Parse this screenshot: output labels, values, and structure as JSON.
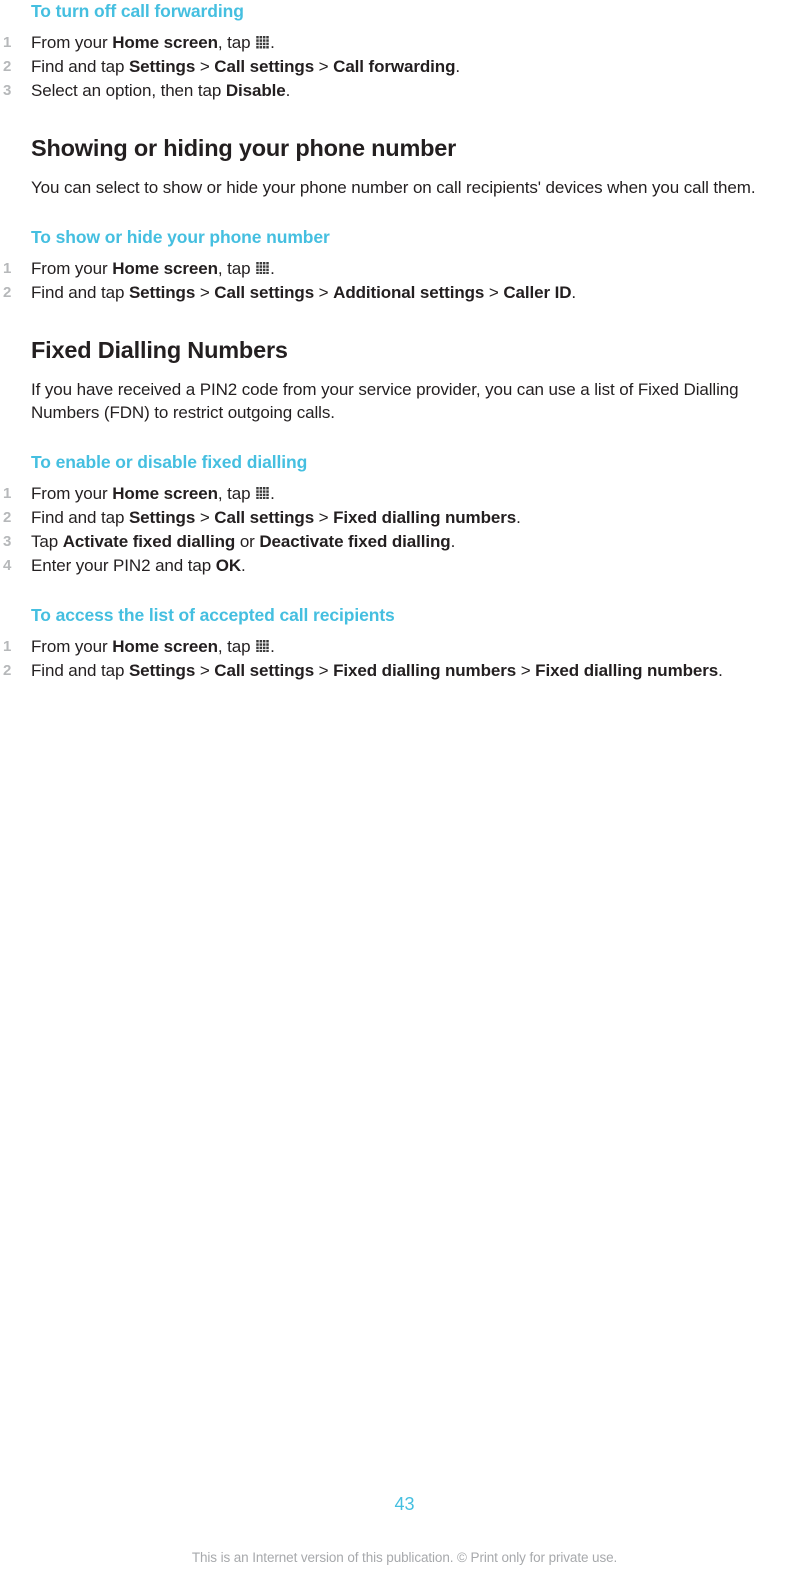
{
  "page": {
    "number": "43",
    "disclaimer": "This is an Internet version of this publication. © Print only for private use.",
    "accent_color": "#45bfe0",
    "text_color": "#231f20",
    "marker_color": "#b6b8ba",
    "footer_color": "#a7a9ac"
  },
  "icons": {
    "app_drawer": "grid-icon"
  },
  "blocks": {
    "proc_turn_off_call_forwarding": {
      "title": "To turn off call forwarding",
      "steps": [
        {
          "parts": [
            {
              "t": "From your ",
              "b": false
            },
            {
              "t": "Home screen",
              "b": true
            },
            {
              "t": ", tap ",
              "b": false
            },
            {
              "t": "ICON",
              "b": false,
              "icon": true
            },
            {
              "t": ".",
              "b": false
            }
          ]
        },
        {
          "parts": [
            {
              "t": "Find and tap ",
              "b": false
            },
            {
              "t": "Settings",
              "b": true
            },
            {
              "t": " > ",
              "b": false,
              "sep": true
            },
            {
              "t": "Call settings",
              "b": true
            },
            {
              "t": " > ",
              "b": false,
              "sep": true
            },
            {
              "t": "Call forwarding",
              "b": true
            },
            {
              "t": ".",
              "b": false
            }
          ]
        },
        {
          "parts": [
            {
              "t": "Select an option, then tap ",
              "b": false
            },
            {
              "t": "Disable",
              "b": true
            },
            {
              "t": ".",
              "b": false
            }
          ]
        }
      ]
    },
    "section_showing_hiding": {
      "title": "Showing or hiding your phone number",
      "paragraph": "You can select to show or hide your phone number on call recipients' devices when you call them."
    },
    "proc_show_hide_number": {
      "title": "To show or hide your phone number",
      "steps": [
        {
          "parts": [
            {
              "t": "From your ",
              "b": false
            },
            {
              "t": "Home screen",
              "b": true
            },
            {
              "t": ", tap ",
              "b": false
            },
            {
              "t": "ICON",
              "b": false,
              "icon": true
            },
            {
              "t": ".",
              "b": false
            }
          ]
        },
        {
          "parts": [
            {
              "t": "Find and tap ",
              "b": false
            },
            {
              "t": "Settings",
              "b": true
            },
            {
              "t": " > ",
              "b": false,
              "sep": true
            },
            {
              "t": "Call settings",
              "b": true
            },
            {
              "t": " > ",
              "b": false,
              "sep": true
            },
            {
              "t": "Additional settings",
              "b": true
            },
            {
              "t": " > ",
              "b": false,
              "sep": true
            },
            {
              "t": "Caller ID",
              "b": true
            },
            {
              "t": ".",
              "b": false
            }
          ]
        }
      ]
    },
    "section_fixed_dialling": {
      "title": "Fixed Dialling Numbers",
      "paragraph": "If you have received a PIN2 code from your service provider, you can use a list of Fixed Dialling Numbers (FDN) to restrict outgoing calls."
    },
    "proc_enable_disable_fixed_dialling": {
      "title": "To enable or disable fixed dialling",
      "steps": [
        {
          "parts": [
            {
              "t": "From your ",
              "b": false
            },
            {
              "t": "Home screen",
              "b": true
            },
            {
              "t": ", tap ",
              "b": false
            },
            {
              "t": "ICON",
              "b": false,
              "icon": true
            },
            {
              "t": ".",
              "b": false
            }
          ]
        },
        {
          "parts": [
            {
              "t": "Find and tap ",
              "b": false
            },
            {
              "t": "Settings",
              "b": true
            },
            {
              "t": " > ",
              "b": false,
              "sep": true
            },
            {
              "t": "Call settings",
              "b": true
            },
            {
              "t": " > ",
              "b": false,
              "sep": true
            },
            {
              "t": "Fixed dialling numbers",
              "b": true
            },
            {
              "t": ".",
              "b": false
            }
          ]
        },
        {
          "parts": [
            {
              "t": "Tap ",
              "b": false
            },
            {
              "t": "Activate fixed dialling",
              "b": true
            },
            {
              "t": " or ",
              "b": false
            },
            {
              "t": "Deactivate fixed dialling",
              "b": true
            },
            {
              "t": ".",
              "b": false
            }
          ]
        },
        {
          "parts": [
            {
              "t": "Enter your PIN2 and tap ",
              "b": false
            },
            {
              "t": "OK",
              "b": true
            },
            {
              "t": ".",
              "b": false
            }
          ]
        }
      ]
    },
    "proc_access_accepted_recipients": {
      "title": "To access the list of accepted call recipients",
      "steps": [
        {
          "parts": [
            {
              "t": "From your ",
              "b": false
            },
            {
              "t": "Home screen",
              "b": true
            },
            {
              "t": ", tap ",
              "b": false
            },
            {
              "t": "ICON",
              "b": false,
              "icon": true
            },
            {
              "t": ".",
              "b": false
            }
          ]
        },
        {
          "parts": [
            {
              "t": "Find and tap ",
              "b": false
            },
            {
              "t": "Settings",
              "b": true
            },
            {
              "t": " > ",
              "b": false,
              "sep": true
            },
            {
              "t": "Call settings",
              "b": true
            },
            {
              "t": " > ",
              "b": false,
              "sep": true
            },
            {
              "t": "Fixed dialling numbers",
              "b": true
            },
            {
              "t": " > ",
              "b": false,
              "sep": true
            },
            {
              "t": "Fixed dialling numbers",
              "b": true
            },
            {
              "t": ".",
              "b": false
            }
          ]
        }
      ]
    }
  }
}
